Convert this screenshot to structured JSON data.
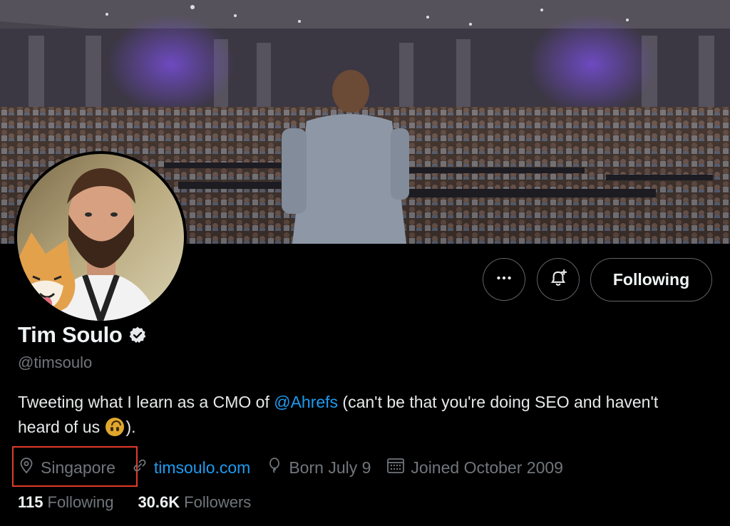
{
  "profile": {
    "name": "Tim Soulo",
    "handle": "@timsoulo",
    "bio_before": "Tweeting what I learn as a CMO of ",
    "bio_mention": "@Ahrefs",
    "bio_after": " (can't be that you're doing SEO and haven't heard of us ",
    "bio_end": ").",
    "bio_emoji": "upside-down-face-emoji",
    "location": "Singapore",
    "website": "timsoulo.com",
    "birthday": "Born July 9",
    "joined": "Joined October 2009",
    "following_count": "115",
    "following_label": "Following",
    "followers_count": "30.6K",
    "followers_label": "Followers"
  },
  "actions": {
    "more_icon": "more-dots-icon",
    "notify_icon": "bell-plus-icon",
    "following_button": "Following"
  },
  "icons": {
    "verified": "verified-badge-icon",
    "location": "location-pin-icon",
    "link": "link-icon",
    "birthday": "balloon-icon",
    "joined": "calendar-icon"
  },
  "colors": {
    "accent": "#1d9bf0",
    "muted": "#71767b",
    "highlight_box": "#e23a2c",
    "background": "#000000"
  }
}
